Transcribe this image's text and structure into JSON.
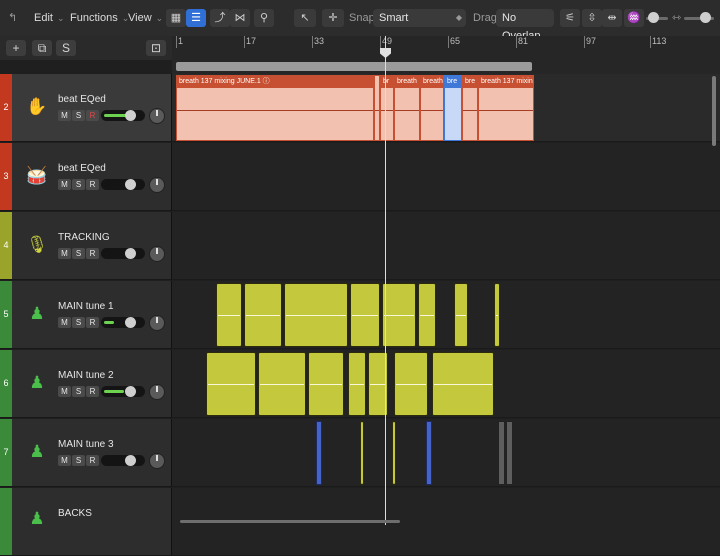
{
  "toolbar": {
    "menus": [
      "Edit",
      "Functions",
      "View"
    ],
    "snap_label": "Snap:",
    "snap_value": "Smart",
    "drag_label": "Drag:",
    "drag_value": "No Overlap"
  },
  "header_buttons": {
    "add": "+",
    "dup": "⧉",
    "solo": "S",
    "catch": "⊡"
  },
  "ruler": {
    "bars": [
      "1",
      "17",
      "33",
      "49",
      "65",
      "81",
      "97",
      "113"
    ]
  },
  "colors": {
    "accent": "#2f6fd6",
    "audio_region": "#c75032",
    "tuned_region": "#c4c83d"
  },
  "tracks": [
    {
      "number": "2",
      "name": "beat EQed",
      "color": "#c2391f",
      "selected": true,
      "icon": "hand-drum-icon",
      "fader_level": 0.55
    },
    {
      "number": "3",
      "name": "beat EQed",
      "color": "#c2391f",
      "selected": false,
      "icon": "drum-kit-icon",
      "fader_level": 0.0
    },
    {
      "number": "4",
      "name": "TRACKING",
      "color": "#9aa32a",
      "selected": false,
      "icon": "microphone-icon",
      "fader_level": 0.0
    },
    {
      "number": "5",
      "name": "MAIN tune 1",
      "color": "#3a8a3a",
      "selected": false,
      "icon": "singer-icon",
      "fader_level": 0.25
    },
    {
      "number": "6",
      "name": "MAIN tune 2",
      "color": "#3a8a3a",
      "selected": false,
      "icon": "singer-icon",
      "fader_level": 0.55
    },
    {
      "number": "7",
      "name": "MAIN tune 3",
      "color": "#3a8a3a",
      "selected": false,
      "icon": "singer-icon",
      "fader_level": 0.0
    },
    {
      "number": "",
      "name": "BACKS",
      "color": "#3a8a3a",
      "selected": false,
      "icon": "singer-icon",
      "fader_level": 0.0
    }
  ],
  "msr_buttons": {
    "mute": "M",
    "solo": "S",
    "record": "R"
  },
  "regions_track2": [
    "breath 137 mixing JUNE.1 ⓘ",
    "br",
    "breath",
    "breath",
    "bre",
    "bre",
    "breath 137 mixin"
  ]
}
